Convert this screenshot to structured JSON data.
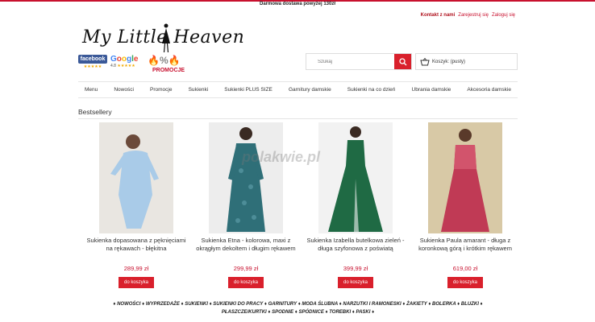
{
  "topbar": {
    "text": "Darmowa dostawa powyżej 130zł"
  },
  "toplinks": {
    "contact": "Kontakt z nami",
    "register": "Zarejestruj się",
    "login": "Zaloguj się"
  },
  "logo": {
    "text": "My Little Heaven"
  },
  "badges": {
    "facebook": "facebook",
    "google": "Google",
    "google_rating": "4.8",
    "promo": "PROMOCJE"
  },
  "search": {
    "placeholder": "Szukaj"
  },
  "cart": {
    "label": "Koszyk: (pusty)"
  },
  "nav": {
    "items": [
      "Menu",
      "Nowości",
      "Promocje",
      "Sukienki",
      "Sukienki PLUS SIZE",
      "Garnitury damskie",
      "Sukienki na co dzień",
      "Ubrania damskie",
      "Akcesoria damskie"
    ]
  },
  "section": {
    "title": "Bestsellery"
  },
  "products": [
    {
      "name": "Sukienka dopasowana z pęknięciami na rękawach - błękitna",
      "price": "289,99 zł",
      "button": "do koszyka",
      "color": "#a9cbe8"
    },
    {
      "name": "Sukienka Etna - kolorowa, maxi z okrągłym dekoltem i długim rękawem",
      "price": "299,99 zł",
      "button": "do koszyka",
      "color": "#2f6f78"
    },
    {
      "name": "Sukienka Izabella butelkowa zieleń - długa szyfonowa z poświatą",
      "price": "399,99 zł",
      "button": "do koszyka",
      "color": "#1f6a44"
    },
    {
      "name": "Sukienka Paula amarant - długa z koronkową górą i krótkim rękawem",
      "price": "619,00 zł",
      "button": "do koszyka",
      "color": "#c03a55"
    }
  ],
  "watermark": {
    "text": "polakwie.pl"
  },
  "footer": {
    "line1": "♦ NOWOŚCI ♦ WYPRZEDAŻE ♦ SUKIENKI ♦ SUKIENKI DO PRACY ♦ GARNITURY ♦ MODA ŚLUBNA ♦ NARZUTKI I RAMONESKI ♦ ŻAKIETY ♦ BOLERKA ♦ BLUZKI ♦",
    "line2": "PŁASZCZE/KURTKI ♦ SPODNIE ♦ SPÓDNICE ♦ TOREBKI ♦ PASKI ♦"
  }
}
